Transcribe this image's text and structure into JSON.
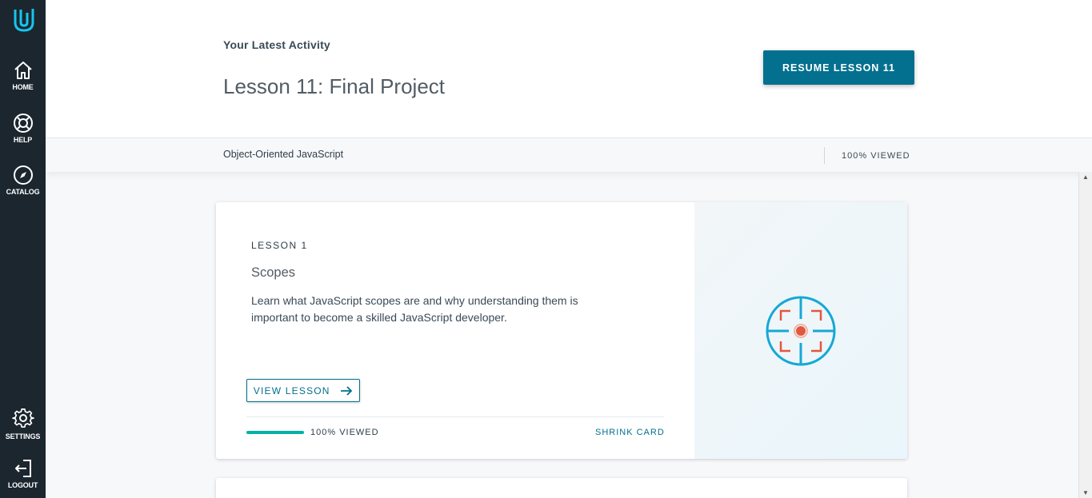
{
  "sidebar": {
    "items": [
      {
        "label": "HOME",
        "icon": "home-icon"
      },
      {
        "label": "HELP",
        "icon": "lifebuoy-icon"
      },
      {
        "label": "CATALOG",
        "icon": "compass-icon"
      },
      {
        "label": "SETTINGS",
        "icon": "gear-icon"
      },
      {
        "label": "LOGOUT",
        "icon": "logout-icon"
      }
    ]
  },
  "header": {
    "activity_label": "Your Latest Activity",
    "lesson_title": "Lesson 11: Final Project",
    "resume_label": "RESUME LESSON 11"
  },
  "subbar": {
    "course_name": "Object-Oriented JavaScript",
    "viewed": "100% VIEWED"
  },
  "card": {
    "lesson_number": "LESSON 1",
    "title": "Scopes",
    "description": "Learn what JavaScript scopes are and why understanding them is important to become a skilled JavaScript developer.",
    "view_label": "VIEW LESSON",
    "progress_text": "100% VIEWED",
    "progress_fraction": 1.0,
    "shrink_label": "SHRINK CARD",
    "image_icon": "target-icon"
  },
  "colors": {
    "sidebar_bg": "#1c262f",
    "accent": "#02708e",
    "progress": "#02b3a4",
    "logo": "#15c5ee",
    "target_ring": "#15a8d6",
    "target_corners": "#e2583e"
  }
}
